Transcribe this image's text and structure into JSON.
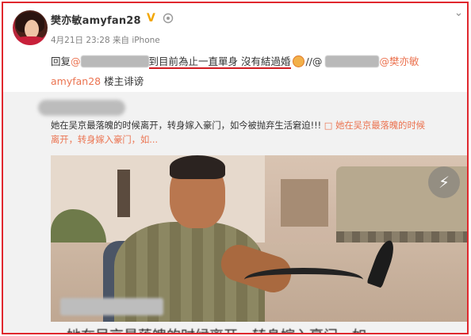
{
  "post": {
    "username": "樊亦敏amyfan28",
    "verified_mark": "V",
    "meta": "4月21日 23:28 来自 iPhone",
    "reply_prefix": "回复",
    "mention_at": "@",
    "highlight_text": "到目前為止一直單身 沒有結過婚",
    "separator": "//@",
    "mention_tail": "@樊亦敏",
    "line2_mention": "amyfan28",
    "line2_text": " 楼主诽谤"
  },
  "repost": {
    "text": "她在吴京最落魄的时候离开，转身嫁入豪门，如今被抛弃生活窘迫!!! ",
    "link_text": "她在吴京最落魄的时候",
    "text_line2": "离开，转身嫁入豪门，如...",
    "bottom_text": "她在吴京最落魄的时候离开，转身嫁入豪门，如"
  },
  "colors": {
    "frame": "#e0282e",
    "mention": "#eb7350",
    "underline": "#d11c22",
    "verified": "#f2a600"
  },
  "icons": {
    "chevron": "chevron-down-icon",
    "badge": "level-badge-icon",
    "flash": "flash-icon",
    "emoji": "emoji-icon"
  }
}
